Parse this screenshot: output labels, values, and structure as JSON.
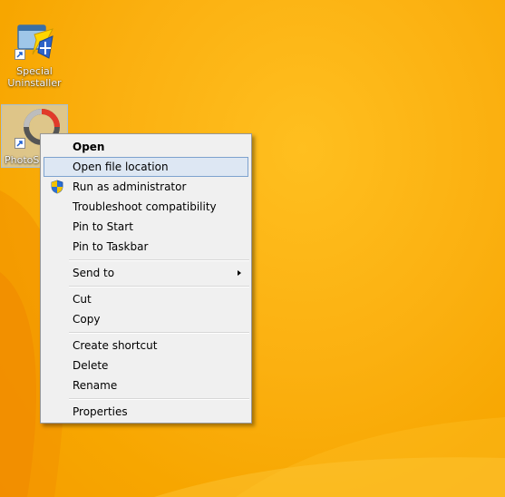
{
  "desktop": {
    "icons": [
      {
        "label": "Special\nUninstaller",
        "icon": "uninstaller-icon"
      },
      {
        "label": "PhotoS",
        "icon": "photoscape-icon"
      }
    ]
  },
  "context_menu": {
    "items": {
      "open": "Open",
      "open_file_location": "Open file location",
      "run_as_admin": "Run as administrator",
      "troubleshoot": "Troubleshoot compatibility",
      "pin_start": "Pin to Start",
      "pin_taskbar": "Pin to Taskbar",
      "send_to": "Send to",
      "cut": "Cut",
      "copy": "Copy",
      "create_shortcut": "Create shortcut",
      "delete": "Delete",
      "rename": "Rename",
      "properties": "Properties"
    },
    "hovered": "Open file location"
  },
  "colors": {
    "desktop": "#f7a600",
    "menu_bg": "#f0f0f0",
    "hover_bg": "#dde7f3",
    "hover_border": "#7da2ce"
  }
}
